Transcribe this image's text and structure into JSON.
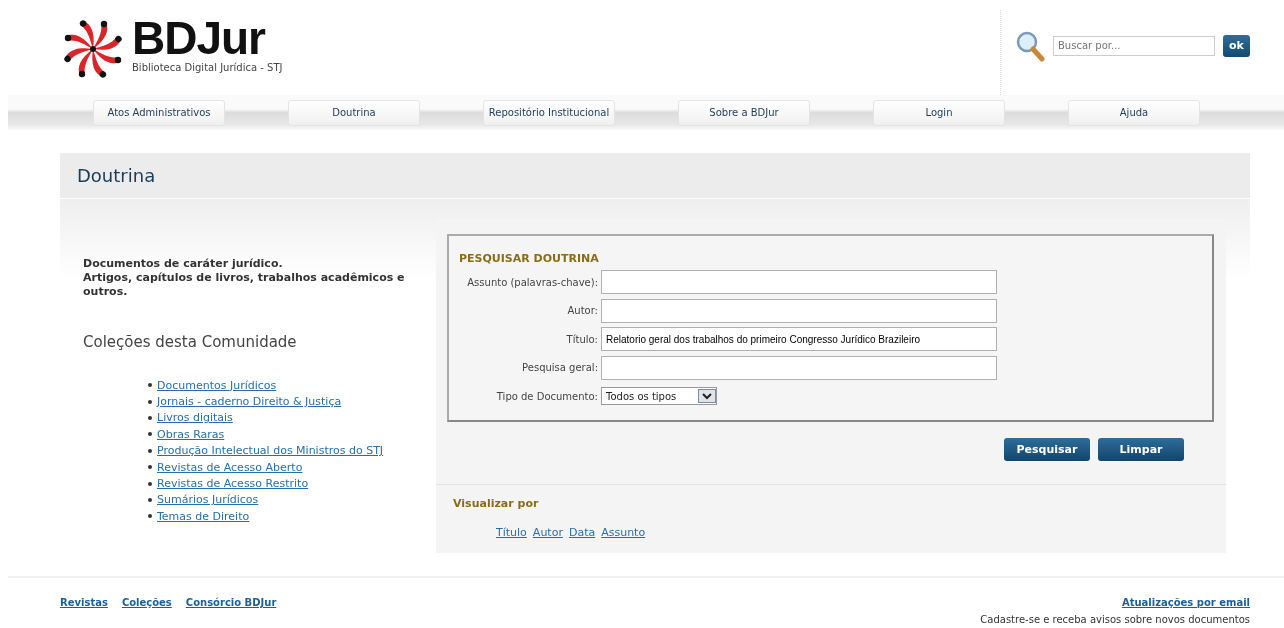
{
  "header": {
    "logo_title": "BDJur",
    "logo_subtitle": "Biblioteca Digital Jurídica - STJ",
    "search": {
      "placeholder": "Buscar por...",
      "button": "ok"
    }
  },
  "nav": [
    "Atos Administrativos",
    "Doutrina",
    "Repositório Institucional",
    "Sobre a BDJur",
    "Login",
    "Ajuda"
  ],
  "page_title": "Doutrina",
  "description": [
    "Documentos de caráter jurídico.",
    "Artigos, capítulos de livros, trabalhos acadêmicos e outros."
  ],
  "collections": {
    "heading": "Coleções desta Comunidade",
    "items": [
      "Documentos Jurídicos",
      "Jornais - caderno Direito & Justiça",
      "Livros digitais",
      "Obras Raras",
      "Produção Intelectual dos Ministros do STJ",
      "Revistas de Acesso Aberto",
      "Revistas de Acesso Restrito",
      "Sumários Jurídicos",
      "Temas de Direito"
    ]
  },
  "search_form": {
    "title": "PESQUISAR DOUTRINA",
    "fields": [
      {
        "kind": "text",
        "label": "Assunto (palavras-chave):"
      },
      {
        "kind": "text",
        "label": "Autor:"
      },
      {
        "kind": "text",
        "label": "Título:",
        "value": "Relatorio geral dos trabalhos do primeiro Congresso Jurídico Brazileiro"
      },
      {
        "kind": "text",
        "label": "Pesquisa geral:"
      },
      {
        "kind": "select",
        "label": "Tipo de Documento:",
        "value": "Todos os tipos"
      }
    ],
    "buttons": [
      "Pesquisar",
      "Limpar"
    ]
  },
  "browse": {
    "title": "Visualizar por",
    "links": [
      "Título",
      "Autor",
      "Data",
      "Assunto"
    ]
  },
  "footer": {
    "links": [
      "Revistas",
      "Coleções",
      "Consórcio BDJur"
    ],
    "email_link": "Atualizações por email",
    "email_note": "Cadastre-se e receba avisos sobre novos documentos"
  }
}
